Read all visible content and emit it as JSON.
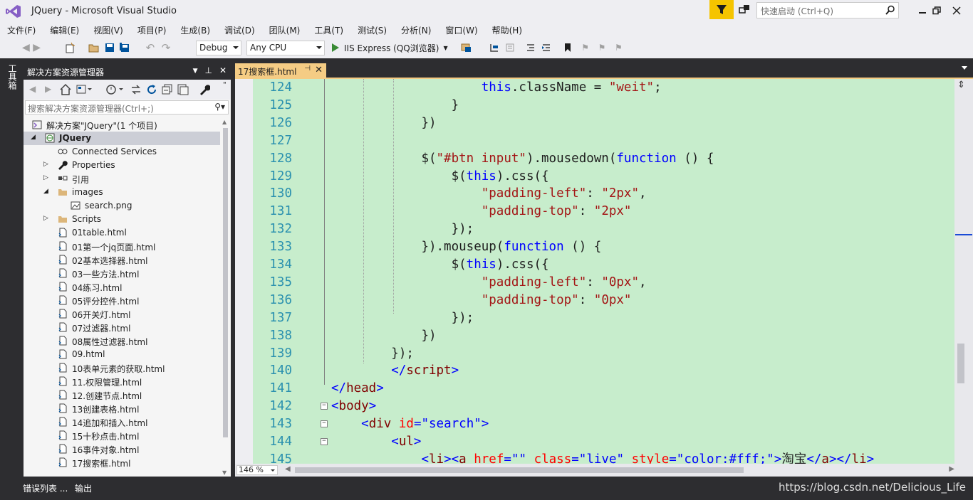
{
  "window": {
    "title": "JQuery - Microsoft Visual Studio",
    "quick_launch_placeholder": "快速启动 (Ctrl+Q)"
  },
  "menu": [
    "文件(F)",
    "编辑(E)",
    "视图(V)",
    "项目(P)",
    "生成(B)",
    "调试(D)",
    "团队(M)",
    "工具(T)",
    "测试(S)",
    "分析(N)",
    "窗口(W)",
    "帮助(H)"
  ],
  "toolbar": {
    "config": "Debug",
    "platform": "Any CPU",
    "run_label": "IIS Express (QQ浏览器)"
  },
  "left_strip": {
    "toolbox_label": "工具箱"
  },
  "solution_explorer": {
    "title": "解决方案资源管理器",
    "search_placeholder": "搜索解决方案资源管理器(Ctrl+;)",
    "nodes": [
      {
        "label": "解决方案\"JQuery\"(1 个项目)",
        "icon": "solution-icon",
        "level": 0,
        "expander": ""
      },
      {
        "label": "JQuery",
        "icon": "web-project-icon",
        "level": 0,
        "expander": "expanded",
        "selected": true,
        "bold": true
      },
      {
        "label": "Connected Services",
        "icon": "connected-services-icon",
        "level": 1,
        "expander": ""
      },
      {
        "label": "Properties",
        "icon": "wrench-icon",
        "level": 1,
        "expander": "collapsed"
      },
      {
        "label": "引用",
        "icon": "references-icon",
        "level": 1,
        "expander": "collapsed"
      },
      {
        "label": "images",
        "icon": "folder-icon",
        "level": 1,
        "expander": "expanded"
      },
      {
        "label": "search.png",
        "icon": "image-file-icon",
        "level": 2,
        "expander": ""
      },
      {
        "label": "Scripts",
        "icon": "folder-icon",
        "level": 1,
        "expander": "collapsed"
      },
      {
        "label": "01table.html",
        "icon": "html-file-icon",
        "level": 1,
        "expander": ""
      },
      {
        "label": "01第一个jq页面.html",
        "icon": "html-file-icon",
        "level": 1,
        "expander": ""
      },
      {
        "label": "02基本选择器.html",
        "icon": "html-file-icon",
        "level": 1,
        "expander": ""
      },
      {
        "label": "03一些方法.html",
        "icon": "html-file-icon",
        "level": 1,
        "expander": ""
      },
      {
        "label": "04练习.html",
        "icon": "html-file-icon",
        "level": 1,
        "expander": ""
      },
      {
        "label": "05评分控件.html",
        "icon": "html-file-icon",
        "level": 1,
        "expander": ""
      },
      {
        "label": "06开关灯.html",
        "icon": "html-file-icon",
        "level": 1,
        "expander": ""
      },
      {
        "label": "07过滤器.html",
        "icon": "html-file-icon",
        "level": 1,
        "expander": ""
      },
      {
        "label": "08属性过滤器.html",
        "icon": "html-file-icon",
        "level": 1,
        "expander": ""
      },
      {
        "label": "09.html",
        "icon": "html-file-icon",
        "level": 1,
        "expander": ""
      },
      {
        "label": "10表单元素的获取.html",
        "icon": "html-file-icon",
        "level": 1,
        "expander": ""
      },
      {
        "label": "11.权限管理.html",
        "icon": "html-file-icon",
        "level": 1,
        "expander": ""
      },
      {
        "label": "12.创建节点.html",
        "icon": "html-file-icon",
        "level": 1,
        "expander": ""
      },
      {
        "label": "13创建表格.html",
        "icon": "html-file-icon",
        "level": 1,
        "expander": ""
      },
      {
        "label": "14追加和插入.html",
        "icon": "html-file-icon",
        "level": 1,
        "expander": ""
      },
      {
        "label": "15十秒点击.html",
        "icon": "html-file-icon",
        "level": 1,
        "expander": ""
      },
      {
        "label": "16事件对象.html",
        "icon": "html-file-icon",
        "level": 1,
        "expander": ""
      },
      {
        "label": "17搜索框.html",
        "icon": "html-file-icon",
        "level": 1,
        "expander": ""
      }
    ]
  },
  "editor": {
    "tab_label": "17搜索框.html",
    "zoom": "146 %",
    "first_line": 124,
    "lines": [
      [
        [
          "            ",
          "p"
        ],
        [
          "this",
          "k"
        ],
        [
          ".className = ",
          "p"
        ],
        [
          "\"weit\"",
          "s"
        ],
        [
          ";",
          "p"
        ]
      ],
      [
        [
          "        }",
          "p"
        ]
      ],
      [
        [
          "    })",
          "p"
        ]
      ],
      [
        [
          "",
          "p"
        ]
      ],
      [
        [
          "    $(",
          "p"
        ],
        [
          "\"#btn input\"",
          "s"
        ],
        [
          ").mousedown(",
          "p"
        ],
        [
          "function",
          "k"
        ],
        [
          " () {",
          "p"
        ]
      ],
      [
        [
          "        $(",
          "p"
        ],
        [
          "this",
          "k"
        ],
        [
          ").css({",
          "p"
        ]
      ],
      [
        [
          "            ",
          "p"
        ],
        [
          "\"padding-left\"",
          "s"
        ],
        [
          ": ",
          "p"
        ],
        [
          "\"2px\"",
          "s"
        ],
        [
          ",",
          "p"
        ]
      ],
      [
        [
          "            ",
          "p"
        ],
        [
          "\"padding-top\"",
          "s"
        ],
        [
          ": ",
          "p"
        ],
        [
          "\"2px\"",
          "s"
        ]
      ],
      [
        [
          "        });",
          "p"
        ]
      ],
      [
        [
          "    }).mouseup(",
          "p"
        ],
        [
          "function",
          "k"
        ],
        [
          " () {",
          "p"
        ]
      ],
      [
        [
          "        $(",
          "p"
        ],
        [
          "this",
          "k"
        ],
        [
          ").css({",
          "p"
        ]
      ],
      [
        [
          "            ",
          "p"
        ],
        [
          "\"padding-left\"",
          "s"
        ],
        [
          ": ",
          "p"
        ],
        [
          "\"0px\"",
          "s"
        ],
        [
          ",",
          "p"
        ]
      ],
      [
        [
          "            ",
          "p"
        ],
        [
          "\"padding-top\"",
          "s"
        ],
        [
          ": ",
          "p"
        ],
        [
          "\"0px\"",
          "s"
        ]
      ],
      [
        [
          "        });",
          "p"
        ]
      ],
      [
        [
          "    })",
          "p"
        ]
      ],
      [
        [
          "});",
          "p"
        ]
      ],
      [
        [
          "</",
          "k"
        ],
        [
          "script",
          "t"
        ],
        [
          ">",
          "k"
        ]
      ],
      [
        [
          "</",
          "k"
        ],
        [
          "head",
          "t"
        ],
        [
          ">",
          "k"
        ]
      ],
      [
        [
          "<",
          "k"
        ],
        [
          "body",
          "t"
        ],
        [
          ">",
          "k"
        ]
      ],
      [
        [
          "<",
          "k"
        ],
        [
          "div",
          "t"
        ],
        [
          " ",
          "p"
        ],
        [
          "id",
          "a"
        ],
        [
          "=",
          "k"
        ],
        [
          "\"search\"",
          "k"
        ],
        [
          ">",
          "k"
        ]
      ],
      [
        [
          "<",
          "k"
        ],
        [
          "ul",
          "t"
        ],
        [
          ">",
          "k"
        ]
      ],
      [
        [
          "<",
          "k"
        ],
        [
          "li",
          "t"
        ],
        [
          "><",
          "k"
        ],
        [
          "a",
          "t"
        ],
        [
          " ",
          "p"
        ],
        [
          "href",
          "a"
        ],
        [
          "=",
          "k"
        ],
        [
          "\"\"",
          "k"
        ],
        [
          " ",
          "p"
        ],
        [
          "class",
          "a"
        ],
        [
          "=",
          "k"
        ],
        [
          "\"live\"",
          "k"
        ],
        [
          " ",
          "p"
        ],
        [
          "style",
          "a"
        ],
        [
          "=",
          "k"
        ],
        [
          "\"color:#fff;\"",
          "k"
        ],
        [
          ">",
          "k"
        ],
        [
          "淘宝",
          "p"
        ],
        [
          "</",
          "k"
        ],
        [
          "a",
          "t"
        ],
        [
          "></",
          "k"
        ],
        [
          "li",
          "t"
        ],
        [
          ">",
          "k"
        ]
      ]
    ]
  },
  "bottom": {
    "tabs": [
      "错误列表 ...",
      "输出"
    ],
    "watermark": "https://blog.csdn.net/Delicious_Life"
  }
}
